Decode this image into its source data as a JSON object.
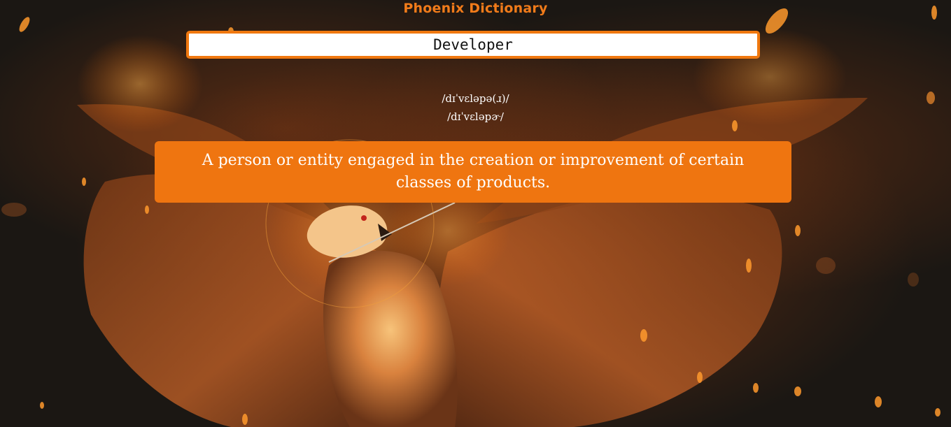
{
  "app": {
    "title": "Phoenix Dictionary"
  },
  "search": {
    "value": "Developer",
    "placeholder": ""
  },
  "phonetics": [
    "/dɪˈvɛləpə(ɹ)/",
    "/dɪˈvɛləpɚ/"
  ],
  "definition": {
    "text": "A person or entity engaged in the creation or improvement of certain classes of products."
  },
  "background": {
    "icon": "phoenix-illustration",
    "accent_color": "#f0780f"
  }
}
